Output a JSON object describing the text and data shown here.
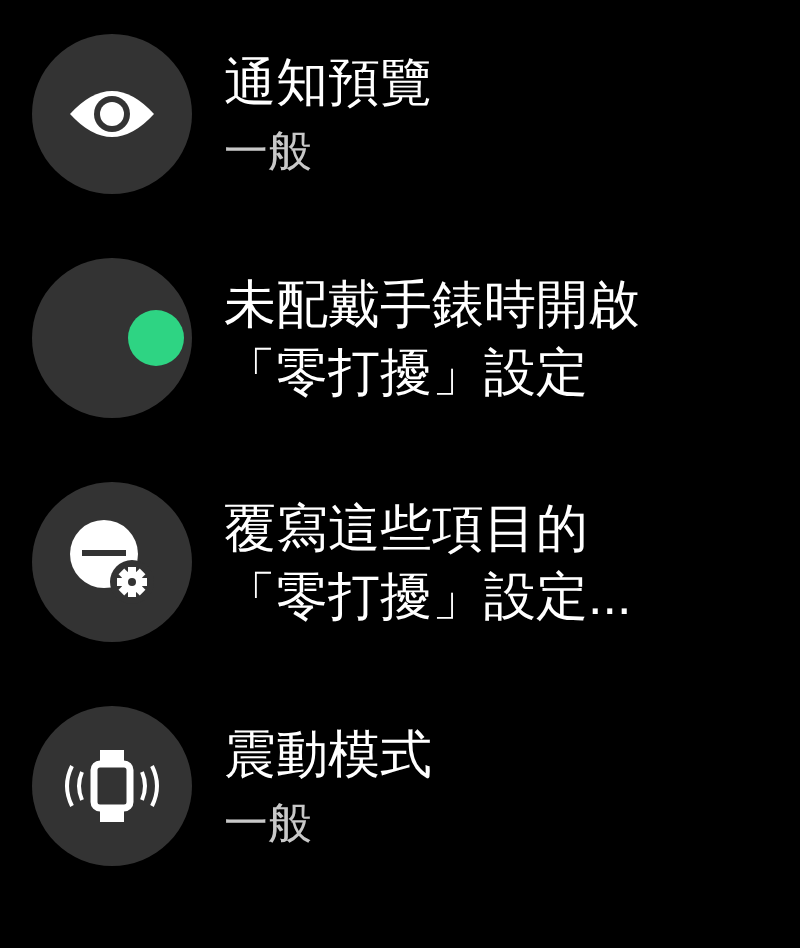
{
  "items": [
    {
      "kind": "icon",
      "title": "通知預覽",
      "subtitle": "一般"
    },
    {
      "kind": "toggle",
      "on": true,
      "title_lines": [
        "未配戴手錶時開啟",
        "「零打擾」設定"
      ]
    },
    {
      "kind": "icon",
      "title_lines": [
        "覆寫這些項目的",
        "「零打擾」設定..."
      ]
    },
    {
      "kind": "icon",
      "title": "震動模式",
      "subtitle": "一般"
    }
  ]
}
